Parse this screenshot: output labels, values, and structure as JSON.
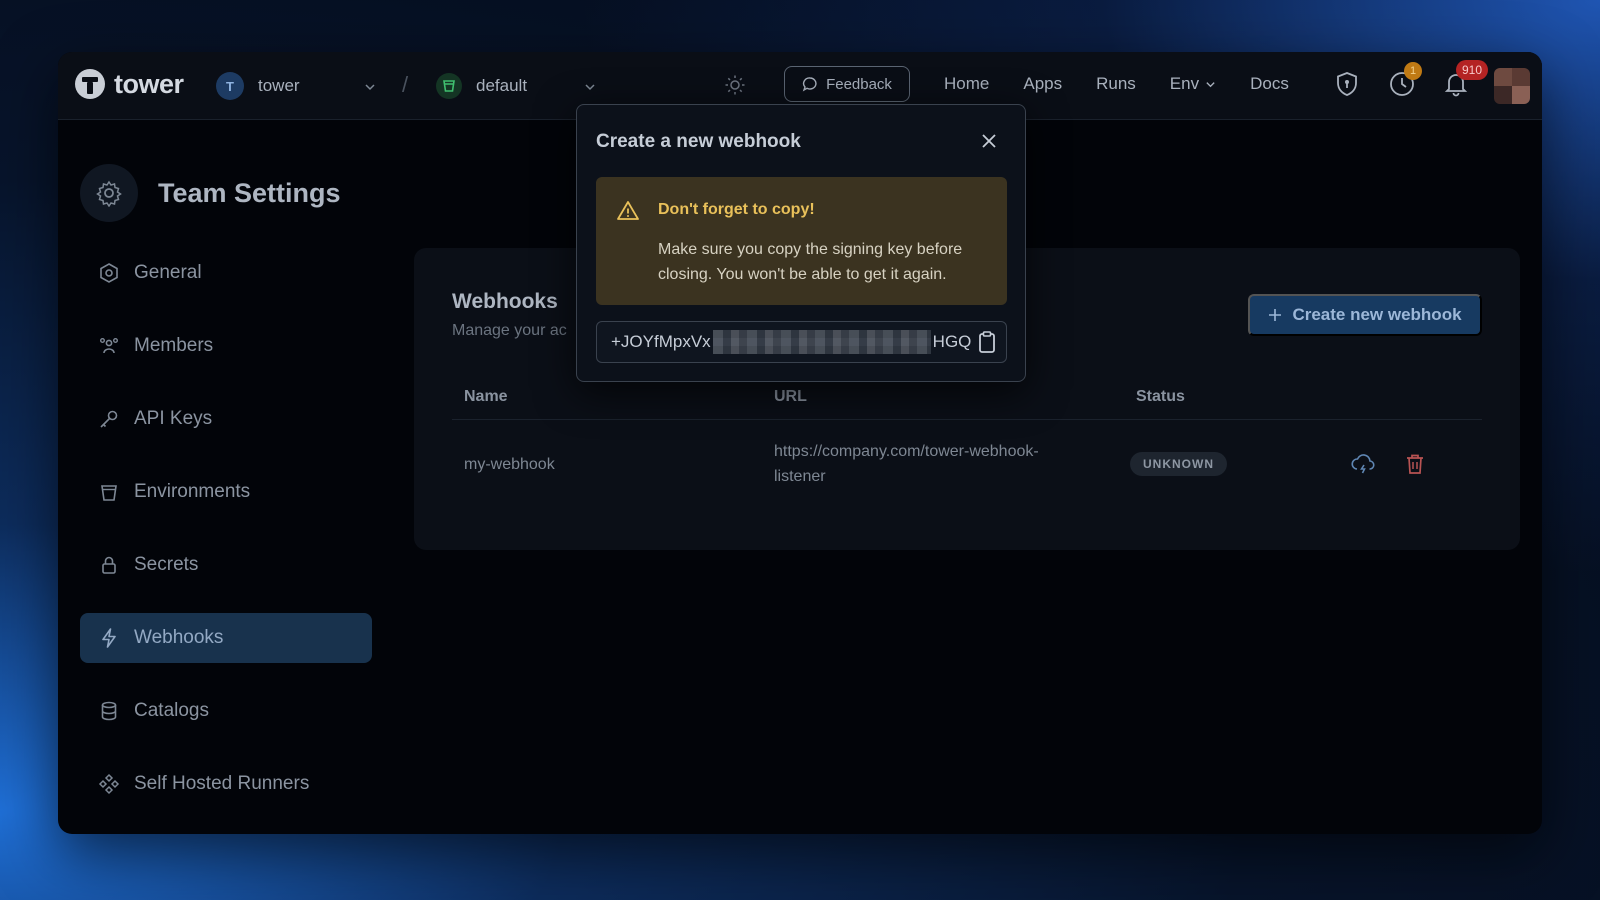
{
  "brand": {
    "name": "tower"
  },
  "team": {
    "initial": "T",
    "name": "tower"
  },
  "environment": {
    "name": "default"
  },
  "nav": {
    "feedback": "Feedback",
    "links": [
      "Home",
      "Apps",
      "Runs",
      "Env",
      "Docs"
    ],
    "clock_badge": "1",
    "bell_badge": "910"
  },
  "page": {
    "title": "Team Settings"
  },
  "sidebar": {
    "items": [
      {
        "label": "General"
      },
      {
        "label": "Members"
      },
      {
        "label": "API Keys"
      },
      {
        "label": "Environments"
      },
      {
        "label": "Secrets"
      },
      {
        "label": "Webhooks"
      },
      {
        "label": "Catalogs"
      },
      {
        "label": "Self Hosted Runners"
      }
    ],
    "active": "Webhooks"
  },
  "webhooks": {
    "title": "Webhooks",
    "subtitle": "Manage your ac",
    "create_label": "Create new webhook",
    "columns": {
      "name": "Name",
      "url": "URL",
      "status": "Status"
    },
    "rows": [
      {
        "name": "my-webhook",
        "url_line1": "https://company.com/tower-webhook-",
        "url_line2": "listener",
        "status": "UNKNOWN"
      }
    ]
  },
  "modal": {
    "title": "Create a new webhook",
    "warning_title": "Don't forget to copy!",
    "warning_body": "Make sure you copy the signing key before closing. You won't be able to get it again.",
    "key_visible_start": "+JOYfMpxVx",
    "key_visible_end": "HGQ"
  },
  "colors": {
    "accent": "#173a61",
    "warning": "#e9c15a",
    "danger": "#b42323",
    "env": "#3fbf6f"
  }
}
